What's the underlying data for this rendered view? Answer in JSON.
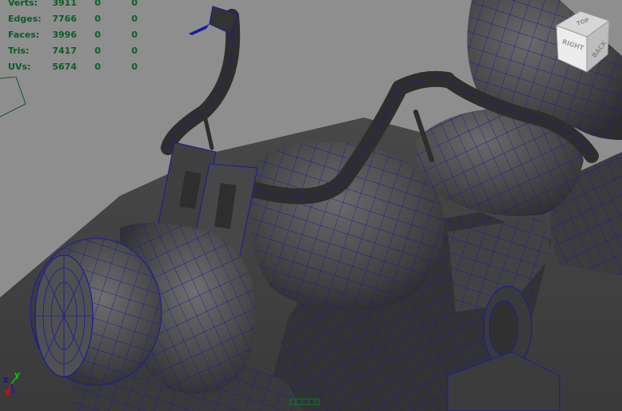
{
  "viewport": {
    "background_color": "#8e8e8e",
    "wireframe_color": "#0000aa",
    "stats_text_color": "#0a5b2a"
  },
  "poly_count": {
    "rows": [
      {
        "label": "Verts:",
        "c1": "3911",
        "c2": "0",
        "c3": "0"
      },
      {
        "label": "Edges:",
        "c1": "7766",
        "c2": "0",
        "c3": "0"
      },
      {
        "label": "Faces:",
        "c1": "3996",
        "c2": "0",
        "c3": "0"
      },
      {
        "label": "Tris:",
        "c1": "7417",
        "c2": "0",
        "c3": "0"
      },
      {
        "label": "UVs:",
        "c1": "5674",
        "c2": "0",
        "c3": "0"
      }
    ]
  },
  "view_cube": {
    "top_label": "TOP",
    "right_label": "RIGHT",
    "back_label": "BACK"
  },
  "axis": {
    "x_label": "x",
    "y_label": "y",
    "z_label": "z",
    "x_color": "#d01010",
    "y_color": "#10c010",
    "z_color": "#1010d0"
  }
}
